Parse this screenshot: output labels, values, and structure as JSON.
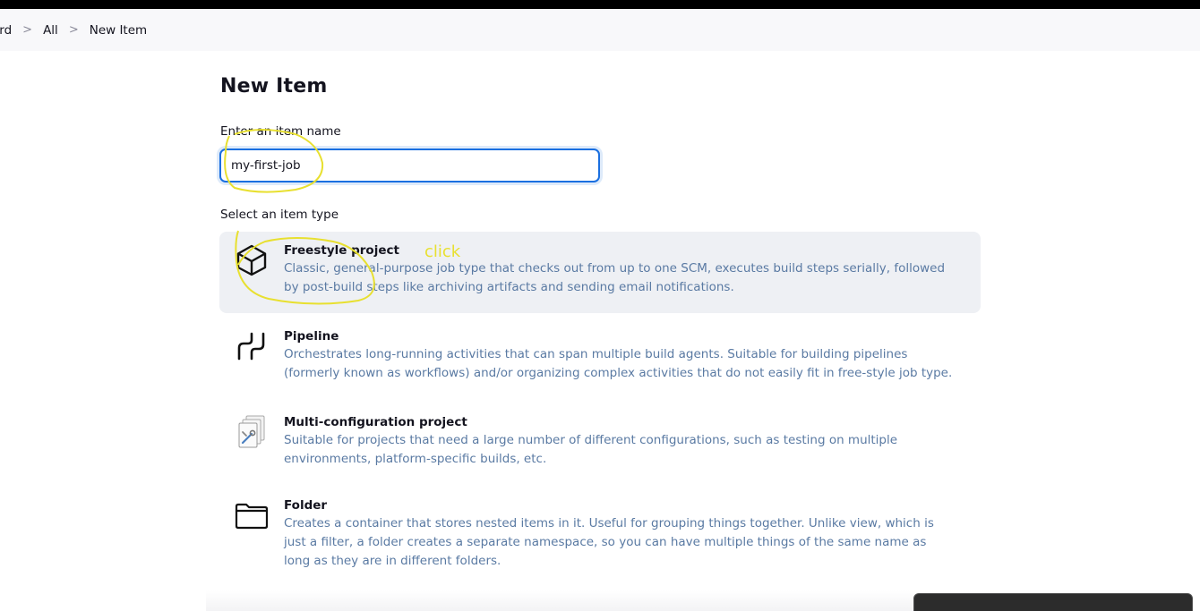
{
  "breadcrumb": {
    "items": [
      "ard",
      "All",
      "New Item"
    ],
    "separator": ">"
  },
  "page": {
    "title": "New Item"
  },
  "name_field": {
    "label": "Enter an item name",
    "value": "my-first-job"
  },
  "type_section": {
    "label": "Select an item type"
  },
  "item_types": [
    {
      "title": "Freestyle project",
      "description": "Classic, general-purpose job type that checks out from up to one SCM, executes build steps serially, followed by post-build steps like archiving artifacts and sending email notifications.",
      "icon": "cube-icon",
      "selected": true
    },
    {
      "title": "Pipeline",
      "description": "Orchestrates long-running activities that can span multiple build agents. Suitable for building pipelines (formerly known as workflows) and/or organizing complex activities that do not easily fit in free-style job type.",
      "icon": "pipeline-icon",
      "selected": false
    },
    {
      "title": "Multi-configuration project",
      "description": "Suitable for projects that need a large number of different configurations, such as testing on multiple environments, platform-specific builds, etc.",
      "icon": "multi-config-icon",
      "selected": false
    },
    {
      "title": "Folder",
      "description": "Creates a container that stores nested items in it. Useful for grouping things together. Unlike view, which is just a filter, a folder creates a separate namespace, so you can have multiple things of the same name as long as they are in different folders.",
      "icon": "folder-icon",
      "selected": false
    }
  ],
  "annotation": {
    "text": "click",
    "color": "#e8e030"
  },
  "colors": {
    "accent": "#1a6fe0",
    "description": "#5a7aa3",
    "selected_bg": "#eef0f4"
  }
}
